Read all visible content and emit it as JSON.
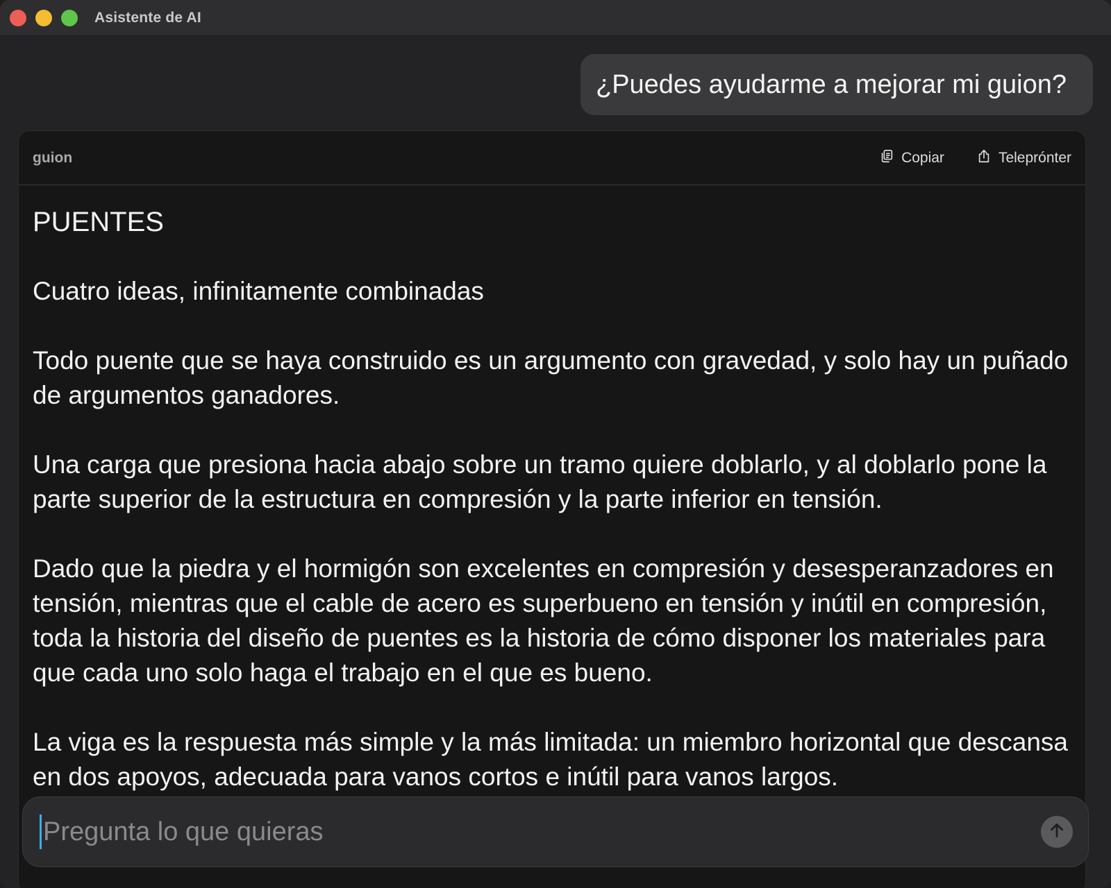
{
  "window": {
    "title": "Asistente de AI"
  },
  "conversation": {
    "user_message": "¿Puedes ayudarme a mejorar mi guion?"
  },
  "script_card": {
    "label": "guion",
    "actions": {
      "copy_label": "Copiar",
      "teleprompter_label": "Teleprónter"
    },
    "paragraphs": [
      "PUENTES",
      "Cuatro ideas, infinitamente combinadas",
      "Todo puente que se haya construido es un argumento con gravedad, y solo hay un puñado de argumentos ganadores.",
      "Una carga que presiona hacia abajo sobre un tramo quiere doblarlo, y al doblarlo pone la parte superior de la estructura en compresión y la parte inferior en tensión.",
      "Dado que la piedra y el hormigón son excelentes en compresión y desesperanzadores en tensión, mientras que el cable de acero es superbueno en tensión y inútil en compresión, toda la historia del diseño de puentes es la historia de cómo disponer los materiales para que cada uno solo haga el trabajo en el que es bueno.",
      "La viga es la respuesta más simple y la más limitada: un miembro horizontal que descansa en dos apoyos, adecuada para vanos cortos e inútil para vanos largos."
    ]
  },
  "composer": {
    "placeholder": "Pregunta lo que quieras",
    "value": ""
  },
  "colors": {
    "window_bg": "#232325",
    "card_bg": "#161617",
    "bubble_bg": "#3a3a3c",
    "caret": "#3ab0e8"
  }
}
